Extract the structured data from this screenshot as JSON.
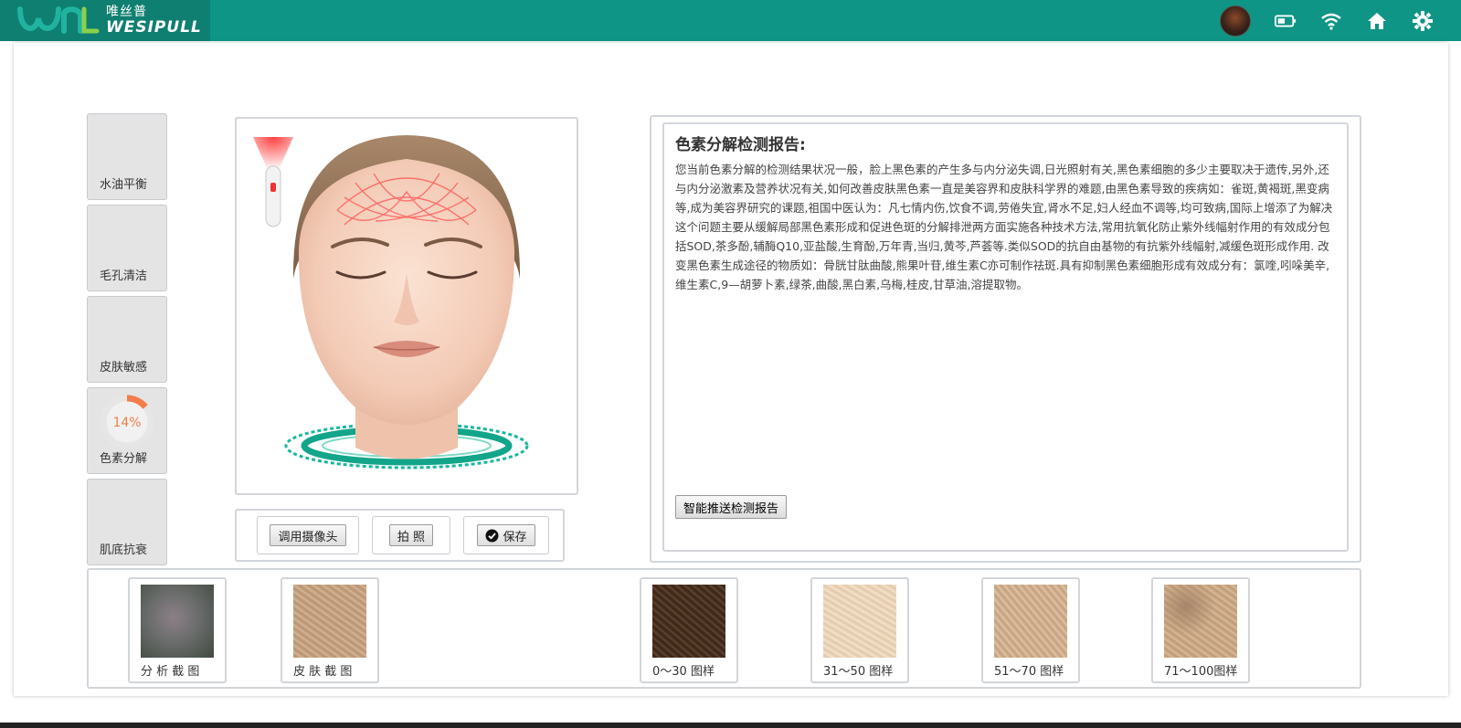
{
  "brand": {
    "cn": "唯丝普",
    "en": "WESIPULL"
  },
  "nav": {
    "items": [
      {
        "label": "水油平衡"
      },
      {
        "label": "毛孔清洁"
      },
      {
        "label": "皮肤敏感"
      },
      {
        "label": "色素分解",
        "progress": "14%",
        "progress_value": 0.14
      },
      {
        "label": "肌底抗衰"
      }
    ]
  },
  "buttons": {
    "camera": "调用摄像头",
    "photo": "拍 照",
    "save": "保存"
  },
  "report": {
    "title": "色素分解检测报告:",
    "body": "您当前色素分解的检测结果状况一般，脸上黑色素的产生多与内分泌失调,日光照射有关,黑色素细胞的多少主要取决于遗传,另外,还与内分泌激素及营养状况有关,如何改善皮肤黑色素一直是美容界和皮肤科学界的难题,由黑色素导致的疾病如：雀斑,黄褐斑,黑变病等,成为美容界研究的课题,祖国中医认为：凡七情内伤,饮食不调,劳倦失宜,肾水不足,妇人经血不调等,均可致病,国际上增添了为解决这个问题主要从缓解局部黑色素形成和促进色斑的分解排泄两方面实施各种技术方法,常用抗氧化防止紫外线幅射作用的有效成分包括SOD,茶多酚,辅酶Q10,亚盐酸,生育酚,万年青,当归,黄芩,芦荟等.类似SOD的抗自由基物的有抗紫外线幅射,减缓色斑形成作用. 改变黑色素生成途径的物质如：骨胱甘肽曲酸,熊果叶苷,维生素C亦可制作祛斑.具有抑制黑色素细胞形成有效成分有：氯喹,吲哚美辛,维生素C,9—胡萝卜素,绿茶,曲酸,黑白素,乌梅,桂皮,甘草油,溶提取物。",
    "push_button": "智能推送检测报告"
  },
  "samples": [
    {
      "caption": "分 析 截 图"
    },
    {
      "caption": "皮 肤 截 图"
    },
    {
      "caption": "0～30 图样"
    },
    {
      "caption": "31～50 图样"
    },
    {
      "caption": "51～70 图样"
    },
    {
      "caption": "71～100图样"
    }
  ],
  "colors": {
    "topbar": "#0e9585",
    "logo_bg": "#0f7f71",
    "progress": "#f47c4a",
    "panel_border": "#d2d5da"
  }
}
